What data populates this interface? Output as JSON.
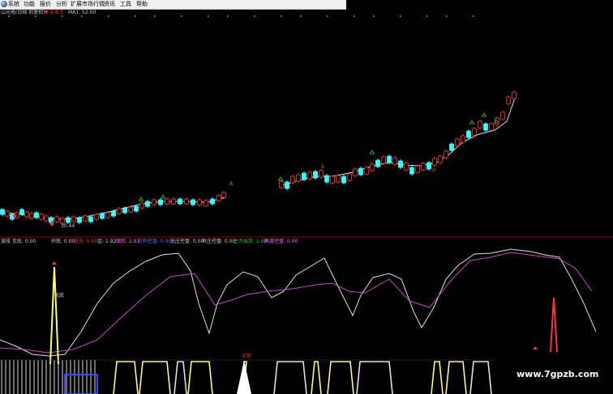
{
  "menu": [
    "系统",
    "功能",
    "报价",
    "分析",
    "扩展市场行情",
    "资讯",
    "工具",
    "帮助"
  ],
  "price_header": {
    "title": "山元电(日线 前复权)",
    "signal_label": "买卖王",
    "ma_label": "MA1: 52.00"
  },
  "price_annotations": {
    "low_price": "30.44",
    "buy_marker": "B",
    "sell_marker": "S",
    "up_marker": "A"
  },
  "indicator_header": {
    "name": "波段 见底: 0.00",
    "items": [
      {
        "text": "抄底: 0.00",
        "color": "#d0d0d0"
      },
      {
        "text": "逃命: 0.00",
        "color": "#ff3333"
      },
      {
        "text": "金: 1.92",
        "color": "#d0d0d0"
      },
      {
        "text": "跟踪: 2.91",
        "color": "#ff66ff"
      },
      {
        "text": "机构控盘: 0.00",
        "color": "#6666ff"
      },
      {
        "text": "无庄控盘: 0.00",
        "color": "#d0d0d0"
      },
      {
        "text": "有庄控盘: 0.00",
        "color": "#d0d0d0"
      },
      {
        "text": "主力出货: 1.00",
        "color": "#33cc33"
      },
      {
        "text": "高度控盘: 0.00",
        "color": "#ff66ff"
      }
    ]
  },
  "indicator_annotations": {
    "bottom_label": "见底",
    "buy_label": "买到"
  },
  "watermark": "www.7gpzb.com",
  "colors": {
    "up": "#ff3333",
    "down": "#33ffff",
    "kline": "#e0e0e0",
    "dline": "#cc44cc",
    "signal_yellow": "#ffff66",
    "divider": "#990000"
  }
}
